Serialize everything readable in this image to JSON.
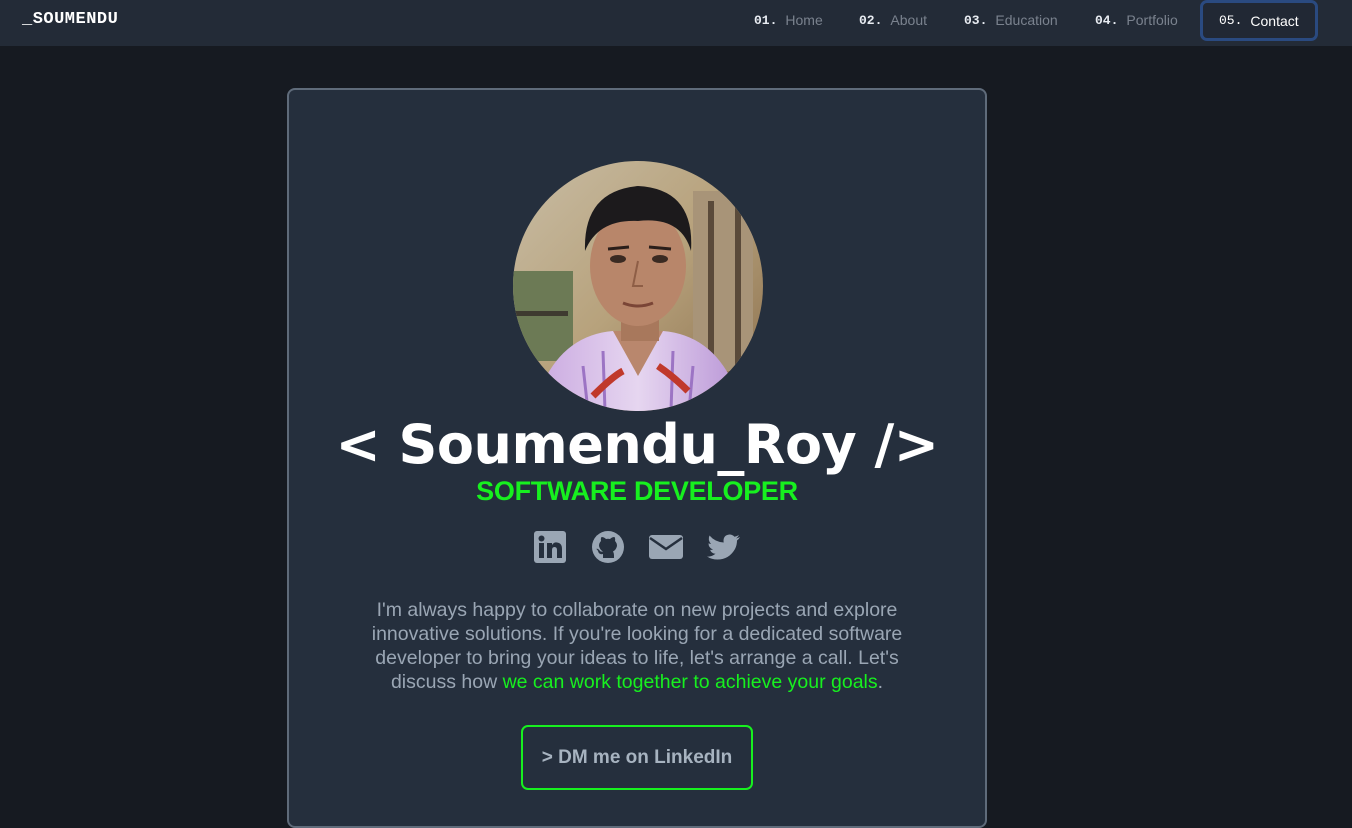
{
  "brand": "_SOUMENDU",
  "nav": [
    {
      "num": "01.",
      "label": "Home"
    },
    {
      "num": "02.",
      "label": "About"
    },
    {
      "num": "03.",
      "label": "Education"
    },
    {
      "num": "04.",
      "label": "Portfolio"
    },
    {
      "num": "05.",
      "label": "Contact",
      "active": true
    }
  ],
  "profile": {
    "name": "< Soumendu_Roy />",
    "role": "SOFTWARE DEVELOPER"
  },
  "socials": [
    {
      "icon": "linkedin-icon"
    },
    {
      "icon": "github-icon"
    },
    {
      "icon": "envelope-icon"
    },
    {
      "icon": "twitter-icon"
    }
  ],
  "about": {
    "text": "I'm always happy to collaborate on new projects and explore innovative solutions. If you're looking for a dedicated software developer to bring your ideas to life, let's arrange a call. Let's discuss how ",
    "highlight": "we can work together to achieve your goals",
    "end": "."
  },
  "cta": "> DM me on LinkedIn",
  "colors": {
    "page_bg": "#161a21",
    "nav_bg": "#232b37",
    "card_bg": "#252f3d",
    "accent_green": "#17f01f",
    "active_border": "#2a4a80"
  }
}
